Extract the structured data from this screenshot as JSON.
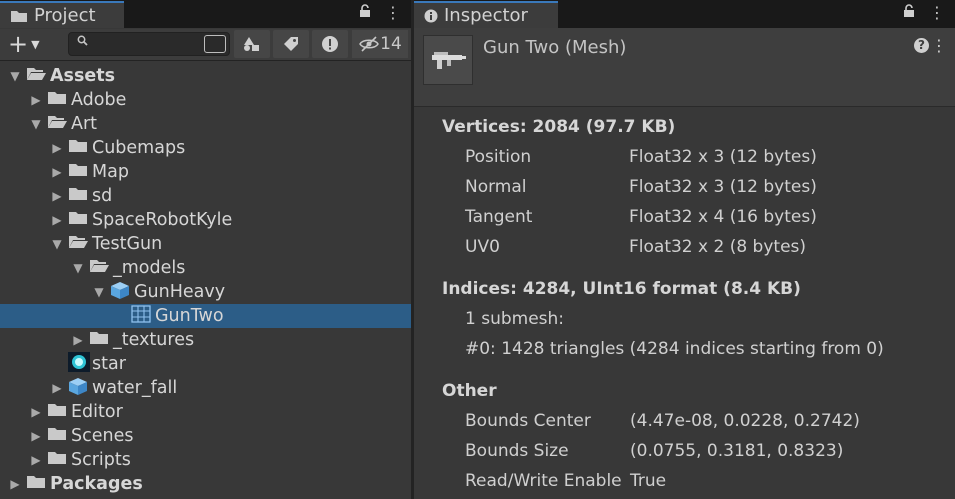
{
  "project": {
    "tab_label": "Project",
    "visibility_count": "14",
    "search_value": "",
    "tree": [
      {
        "label": "Assets",
        "depth": 0,
        "arrow": "open",
        "icon": "folder-open",
        "bold": true
      },
      {
        "label": "Adobe",
        "depth": 1,
        "arrow": "closed",
        "icon": "folder"
      },
      {
        "label": "Art",
        "depth": 1,
        "arrow": "open",
        "icon": "folder-open"
      },
      {
        "label": "Cubemaps",
        "depth": 2,
        "arrow": "closed",
        "icon": "folder"
      },
      {
        "label": "Map",
        "depth": 2,
        "arrow": "closed",
        "icon": "folder"
      },
      {
        "label": "sd",
        "depth": 2,
        "arrow": "closed",
        "icon": "folder"
      },
      {
        "label": "SpaceRobotKyle",
        "depth": 2,
        "arrow": "closed",
        "icon": "folder"
      },
      {
        "label": "TestGun",
        "depth": 2,
        "arrow": "open",
        "icon": "folder-open"
      },
      {
        "label": "_models",
        "depth": 3,
        "arrow": "open",
        "icon": "folder-open"
      },
      {
        "label": "GunHeavy",
        "depth": 4,
        "arrow": "open",
        "icon": "prefab"
      },
      {
        "label": "GunTwo",
        "depth": 5,
        "arrow": "none",
        "icon": "mesh",
        "selected": true
      },
      {
        "label": "_textures",
        "depth": 3,
        "arrow": "closed",
        "icon": "folder"
      },
      {
        "label": "star",
        "depth": 2,
        "arrow": "none",
        "icon": "material"
      },
      {
        "label": "water_fall",
        "depth": 2,
        "arrow": "closed",
        "icon": "prefab"
      },
      {
        "label": "Editor",
        "depth": 1,
        "arrow": "closed",
        "icon": "folder"
      },
      {
        "label": "Scenes",
        "depth": 1,
        "arrow": "closed",
        "icon": "folder"
      },
      {
        "label": "Scripts",
        "depth": 1,
        "arrow": "closed",
        "icon": "folder"
      },
      {
        "label": "Packages",
        "depth": 0,
        "arrow": "closed",
        "icon": "folder",
        "bold": true
      }
    ]
  },
  "inspector": {
    "tab_label": "Inspector",
    "title": "Gun Two (Mesh)",
    "vertices_header": "Vertices: 2084 (97.7 KB)",
    "attributes": [
      {
        "name": "Position",
        "value": "Float32 x 3 (12 bytes)"
      },
      {
        "name": "Normal",
        "value": "Float32 x 3 (12 bytes)"
      },
      {
        "name": "Tangent",
        "value": "Float32 x 4 (16 bytes)"
      },
      {
        "name": "UV0",
        "value": "Float32 x 2 (8 bytes)"
      }
    ],
    "indices_header": "Indices: 4284, UInt16 format (8.4 KB)",
    "submesh_count": "1 submesh:",
    "submesh_detail": "#0: 1428 triangles (4284 indices starting from 0)",
    "other_header": "Other",
    "other": [
      {
        "name": "Bounds Center",
        "value": "(4.47e-08, 0.0228, 0.2742)"
      },
      {
        "name": "Bounds Size",
        "value": "(0.0755, 0.3181, 0.8323)"
      },
      {
        "name": "Read/Write Enable",
        "value": "True"
      }
    ]
  },
  "colors": {
    "selection": "#2c5d87",
    "tab_accent": "#3a79bb",
    "background": "#383838"
  }
}
